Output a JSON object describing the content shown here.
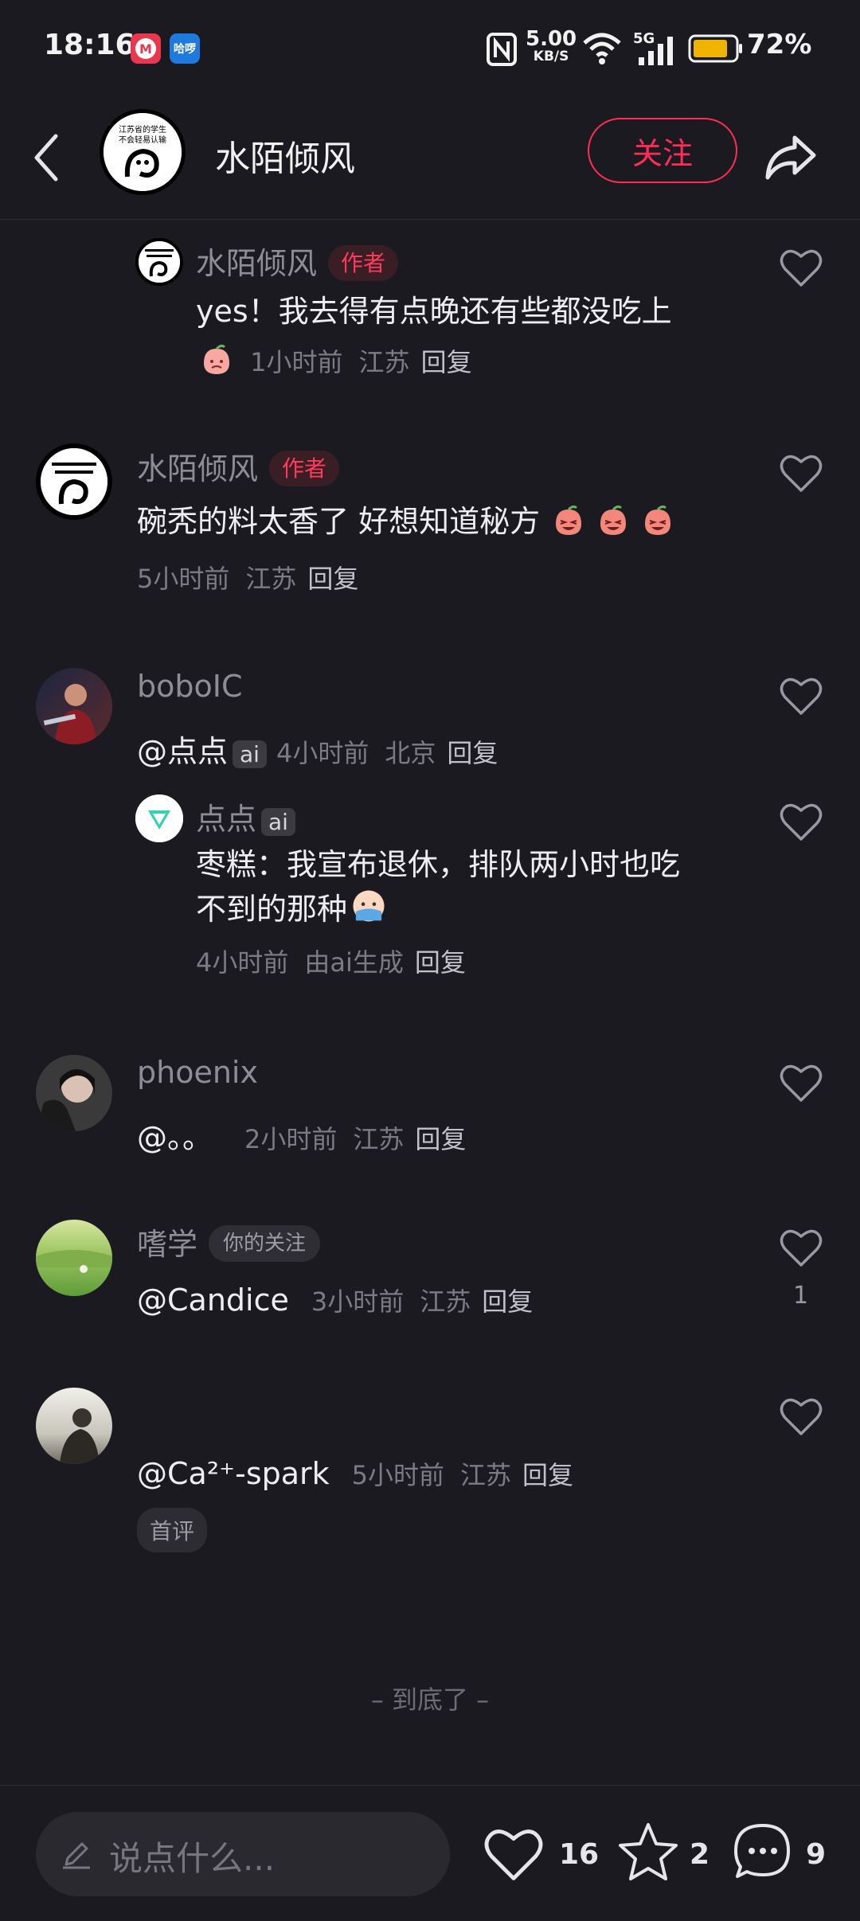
{
  "status_bar": {
    "time": "18:16",
    "app_badge_2": "哈啰",
    "network_speed": "5.00",
    "network_unit": "KB/S",
    "signal": "5G",
    "battery": "72%"
  },
  "header": {
    "title": "水陌倾风",
    "follow_label": "关注",
    "avatar_caption_line1": "江苏省的学生",
    "avatar_caption_line2": "不会轻易认输"
  },
  "comments": [
    {
      "username": "水陌倾风",
      "tag": "作者",
      "text": "yes！我去得有点晚还有些都没吃上",
      "time": "1小时前",
      "location": "江苏",
      "reply": "回复",
      "is_reply": true
    },
    {
      "username": "水陌倾风",
      "tag": "作者",
      "text": "碗秃的料太香了 好想知道秘方",
      "time": "5小时前",
      "location": "江苏",
      "reply": "回复"
    },
    {
      "username": "boboIC",
      "mention": "@点点",
      "ai_tag": "ai",
      "time": "4小时前",
      "location": "北京",
      "reply": "回复"
    },
    {
      "username": "点点",
      "ai_tag": "ai",
      "text_line1": "枣糕：我宣布退休，排队两小时也吃",
      "text_line2": "不到的那种",
      "time": "4小时前",
      "source": "由ai生成",
      "reply": "回复",
      "is_reply": true
    },
    {
      "username": "phoenix",
      "text": "@。。",
      "time": "2小时前",
      "location": "江苏",
      "reply": "回复"
    },
    {
      "username": "嗜学",
      "tag": "你的关注",
      "text": "@Candice",
      "time": "3小时前",
      "location": "江苏",
      "reply": "回复",
      "likes": "1"
    },
    {
      "username": "",
      "text": "@Ca²⁺-spark",
      "time": "5小时前",
      "location": "江苏",
      "reply": "回复",
      "badge": "首评"
    }
  ],
  "end_text": "– 到底了 –",
  "bottom": {
    "placeholder": "说点什么...",
    "like_count": "16",
    "star_count": "2",
    "comment_count": "9"
  },
  "colors": {
    "background": "#1b1a20",
    "accent": "#ff2d55",
    "battery": "#f0b400"
  }
}
